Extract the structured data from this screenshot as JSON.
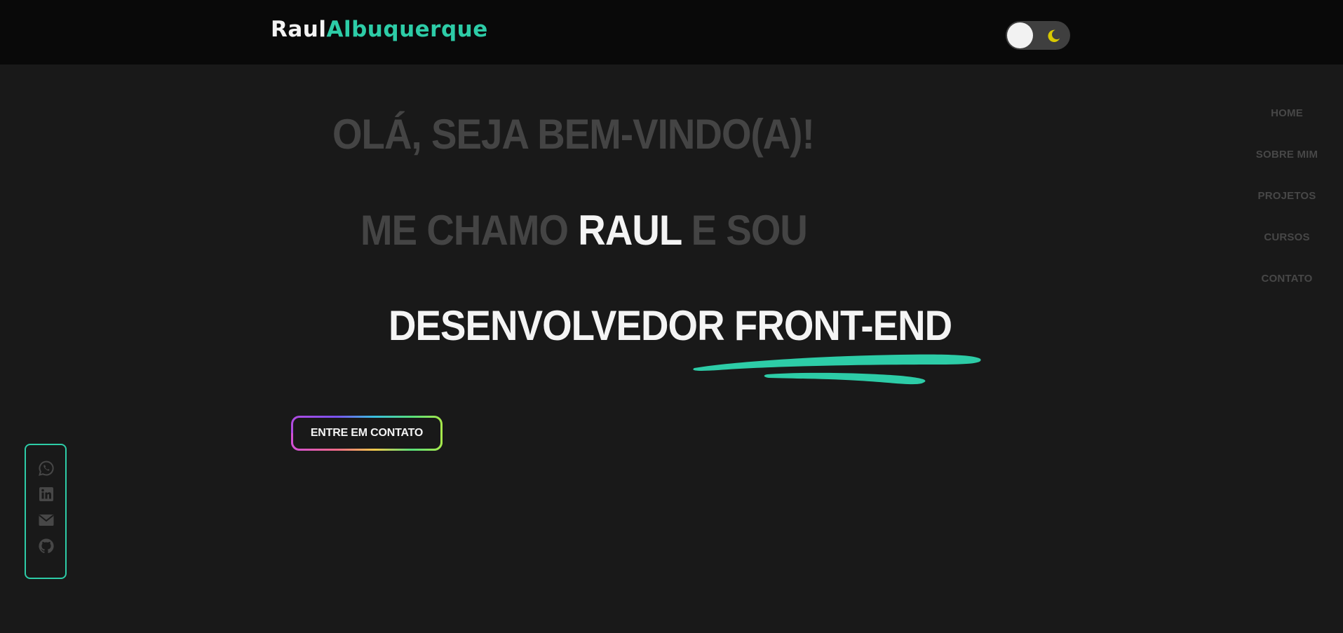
{
  "logo": {
    "first": "Raul",
    "last": "Albuquerque"
  },
  "theme_toggle": {
    "icon": "moon-icon"
  },
  "nav": {
    "items": [
      "HOME",
      "SOBRE MIM",
      "PROJETOS",
      "CURSOS",
      "CONTATO"
    ]
  },
  "hero": {
    "line1": "OLÁ, SEJA BEM-VINDO(A)!",
    "line2_pre": "ME CHAMO ",
    "line2_name": "RAUL",
    "line2_post": " E SOU",
    "line3": "DESENVOLVEDOR FRONT-END"
  },
  "cta": {
    "label": "ENTRE EM CONTATO"
  },
  "social": {
    "icons": [
      "whatsapp-icon",
      "linkedin-icon",
      "email-icon",
      "github-icon"
    ]
  },
  "colors": {
    "accent": "#2dcca7",
    "background": "#191919",
    "header": "#090909",
    "muted_text": "#444444",
    "moon": "#d8c800"
  }
}
